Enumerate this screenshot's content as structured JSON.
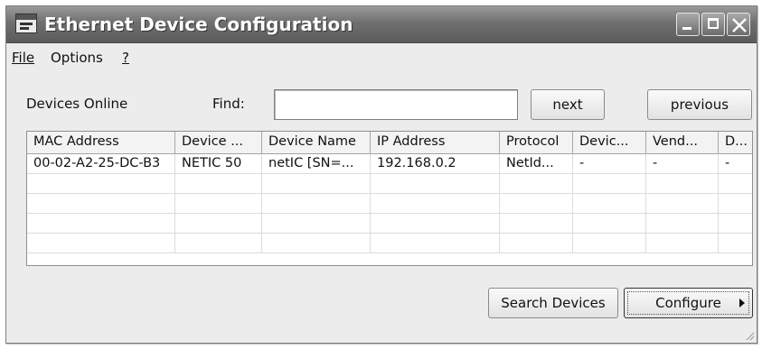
{
  "window": {
    "title": "Ethernet Device Configuration"
  },
  "menu": {
    "file": "File",
    "options": "Options",
    "help": "?"
  },
  "toolbar": {
    "devices_online_label": "Devices Online",
    "find_label": "Find:",
    "find_value": "",
    "next_label": "next",
    "previous_label": "previous"
  },
  "table": {
    "columns": [
      "MAC Address",
      "Device ...",
      "Device Name",
      "IP Address",
      "Protocol",
      "Devic...",
      "Vend...",
      "D..."
    ],
    "rows": [
      [
        "00-02-A2-25-DC-B3",
        "NETIC 50",
        "netIC [SN=...",
        "192.168.0.2",
        "NetId...",
        "-",
        "-",
        "-"
      ]
    ]
  },
  "buttons": {
    "search": "Search Devices",
    "configure": "Configure"
  }
}
